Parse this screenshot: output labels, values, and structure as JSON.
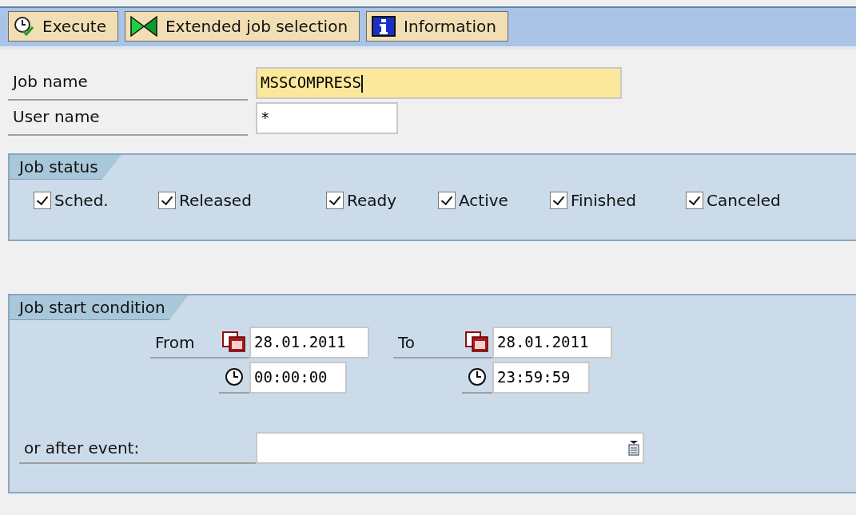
{
  "toolbar": [
    {
      "label": "Execute",
      "kind": "execute"
    },
    {
      "label": "Extended job selection",
      "kind": "extended"
    },
    {
      "label": "Information",
      "kind": "info"
    }
  ],
  "criteria": [
    {
      "label": "Job name",
      "value": "MSSCOMPRESS",
      "focused": true
    },
    {
      "label": "User name",
      "value": "*",
      "focused": false
    }
  ],
  "job_status": {
    "title": "Job status",
    "options": [
      {
        "label": "Sched.",
        "checked": true
      },
      {
        "label": "Released",
        "checked": true
      },
      {
        "label": "Ready",
        "checked": true
      },
      {
        "label": "Active",
        "checked": true
      },
      {
        "label": "Finished",
        "checked": true
      },
      {
        "label": "Canceled",
        "checked": true
      }
    ]
  },
  "start_condition": {
    "title": "Job start condition",
    "from_label": "From",
    "from_date": "28.01.2011",
    "from_time": "00:00:00",
    "to_label": "To",
    "to_date": "28.01.2011",
    "to_time": "23:59:59",
    "event_label": "or after event:"
  }
}
